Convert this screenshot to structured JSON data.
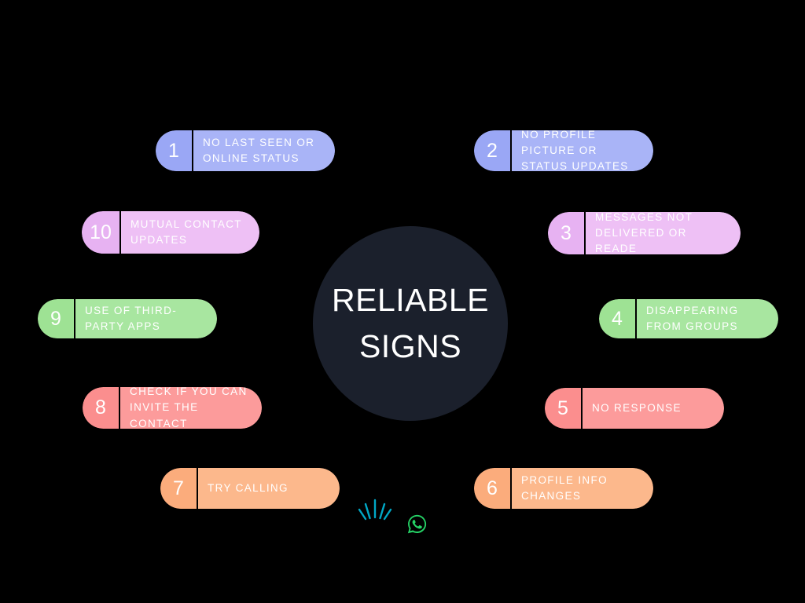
{
  "center": {
    "title_line1": "RELIABLE",
    "title_line2": "SIGNS",
    "circle_color": "#1b202c",
    "text_color": "#ffffff"
  },
  "background_color": "#000000",
  "items": [
    {
      "number": "1",
      "label": "NO LAST SEEN OR ONLINE STATUS",
      "body_color": "#a9b4f7",
      "cap_color": "#9aa7f5",
      "side": "left"
    },
    {
      "number": "2",
      "label": "NO PROFILE PICTURE OR STATUS UPDATES",
      "body_color": "#a9b4f7",
      "cap_color": "#9aa7f5",
      "side": "right"
    },
    {
      "number": "3",
      "label": "MESSAGES NOT DELIVERED OR READE",
      "body_color": "#eec0f5",
      "cap_color": "#e7b2f2",
      "side": "right"
    },
    {
      "number": "4",
      "label": "DISAPPEARING FROM GROUPS",
      "body_color": "#a8e6a0",
      "cap_color": "#9ee294",
      "side": "right"
    },
    {
      "number": "5",
      "label": "NO RESPONSE",
      "body_color": "#fc9b9b",
      "cap_color": "#fb8e8e",
      "side": "right"
    },
    {
      "number": "6",
      "label": "PROFILE INFO CHANGES",
      "body_color": "#fcb88c",
      "cap_color": "#fbac7c",
      "side": "right"
    },
    {
      "number": "7",
      "label": "TRY CALLING",
      "body_color": "#fcb88c",
      "cap_color": "#fbac7c",
      "side": "left"
    },
    {
      "number": "8",
      "label": "CHECK IF YOU CAN INVITE THE CONTACT",
      "body_color": "#fc9b9b",
      "cap_color": "#fb8e8e",
      "side": "left"
    },
    {
      "number": "9",
      "label": "USE OF THIRD-PARTY APPS",
      "body_color": "#a8e6a0",
      "cap_color": "#9ee294",
      "side": "left"
    },
    {
      "number": "10",
      "label": "MUTUAL CONTACT UPDATES",
      "body_color": "#eec0f5",
      "cap_color": "#e7b2f2",
      "side": "left"
    }
  ],
  "decorations": {
    "burst_icon": "burst-rays-icon",
    "burst_color": "#00a8c6",
    "whatsapp_icon": "whatsapp-logo-icon",
    "whatsapp_color": "#25d366"
  }
}
